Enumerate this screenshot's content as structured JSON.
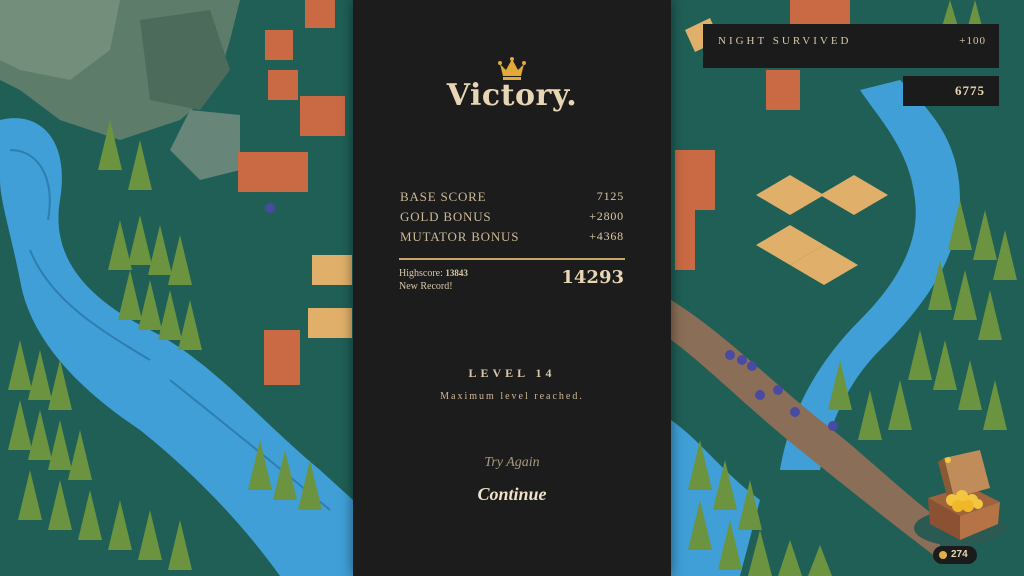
{
  "victory": {
    "title": "Victory.",
    "scores": [
      {
        "label": "BASE SCORE",
        "value": "7125"
      },
      {
        "label": "GOLD BONUS",
        "value": "+2800"
      },
      {
        "label": "MUTATOR BONUS",
        "value": "+4368"
      }
    ],
    "highscore_label": "Highscore:",
    "highscore_value": "13843",
    "new_record": "New Record!",
    "total": "14293",
    "level": "LEVEL 14",
    "level_sub": "Maximum level reached.",
    "try_again": "Try Again",
    "continue": "Continue"
  },
  "hud": {
    "night_label": "NIGHT SURVIVED",
    "night_bonus": "+100",
    "score": "6775",
    "gold": "274"
  },
  "colors": {
    "panel": "#1c1c1c",
    "accent_gold": "#c9a66a",
    "text": "#d8c8a8",
    "water": "#3f9fd6",
    "grass": "#1f5f56"
  },
  "icons": [
    "crown-icon",
    "treasure-chest-icon",
    "coin-icon"
  ]
}
